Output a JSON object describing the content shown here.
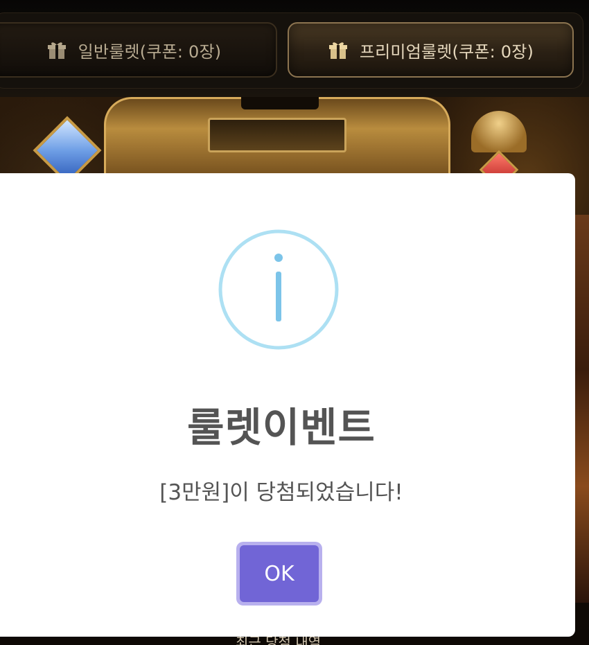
{
  "tabs": {
    "normal": {
      "label": "일반룰렛(쿠폰: 0장)",
      "icon": "gift-icon"
    },
    "premium": {
      "label": "프리미엄룰렛(쿠폰: 0장)",
      "icon": "gift-icon"
    }
  },
  "background": {
    "recent_wins_label": "최근 당첨 내역"
  },
  "modal": {
    "icon": "info-icon",
    "title": "룰렛이벤트",
    "message": "[3만원]이 당첨되었습니다!",
    "ok_label": "OK"
  },
  "colors": {
    "accent": "#7165d6",
    "info_icon": "#7cc4e9",
    "gold": "#c79a45"
  }
}
